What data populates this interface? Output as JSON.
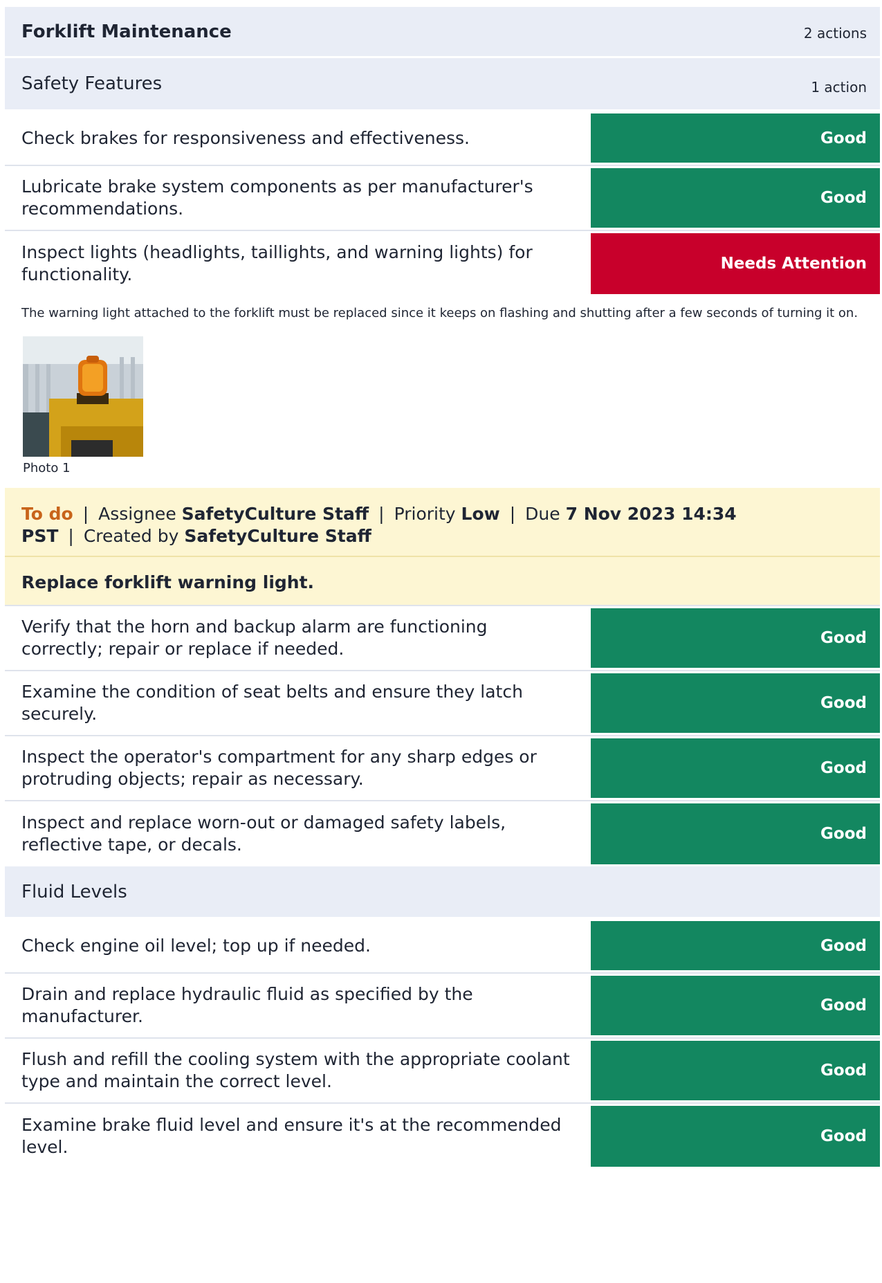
{
  "section": {
    "title": "Forklift Maintenance",
    "count": "2 actions"
  },
  "subsections": [
    {
      "title": "Safety Features",
      "count": "1 action"
    },
    {
      "title": "Fluid Levels",
      "count": ""
    }
  ],
  "safety_items": [
    {
      "question": "Check brakes for responsiveness and effectiveness.",
      "response": "Good"
    },
    {
      "question": "Lubricate brake system components as per manufacturer's recommendations.",
      "response": "Good"
    },
    {
      "question": "Inspect lights (headlights, taillights, and warning lights) for functionality.",
      "response": "Needs Attention"
    }
  ],
  "note": "The warning light attached to the forklift must be replaced since it keeps on flashing and shutting after a few seconds of turning it on.",
  "photo": {
    "caption": "Photo 1"
  },
  "action": {
    "status": "To do",
    "assignee_label": "Assignee",
    "assignee": "SafetyCulture Staff",
    "priority_label": "Priority",
    "priority": "Low",
    "due_label": "Due",
    "due": "7 Nov 2023 14:34 PST",
    "created_label": "Created by",
    "created_by": "SafetyCulture Staff",
    "separator": "|",
    "title": "Replace forklift warning light."
  },
  "safety_items_after": [
    {
      "question": "Verify that the horn and backup alarm are functioning correctly; repair or replace if needed.",
      "response": "Good"
    },
    {
      "question": "Examine the condition of seat belts and ensure they latch securely.",
      "response": "Good"
    },
    {
      "question": "Inspect the operator's compartment for any sharp edges or protruding objects; repair as necessary.",
      "response": "Good"
    },
    {
      "question": "Inspect and replace worn-out or damaged safety labels, reflective tape, or decals.",
      "response": "Good"
    }
  ],
  "fluid_items": [
    {
      "question": "Check engine oil level; top up if needed.",
      "response": "Good"
    },
    {
      "question": "Drain and replace hydraulic fluid as specified by the manufacturer.",
      "response": "Good"
    },
    {
      "question": "Flush and refill the cooling system with the appropriate coolant type and maintain the correct level.",
      "response": "Good"
    },
    {
      "question": "Examine brake fluid level and ensure it's at the recommended level.",
      "response": "Good"
    }
  ],
  "colors": {
    "good": "#138760",
    "needs_attention": "#c8002b",
    "section_bg": "#e9edf6",
    "action_bg": "#fdf6d3",
    "status_todo": "#c8641a"
  }
}
